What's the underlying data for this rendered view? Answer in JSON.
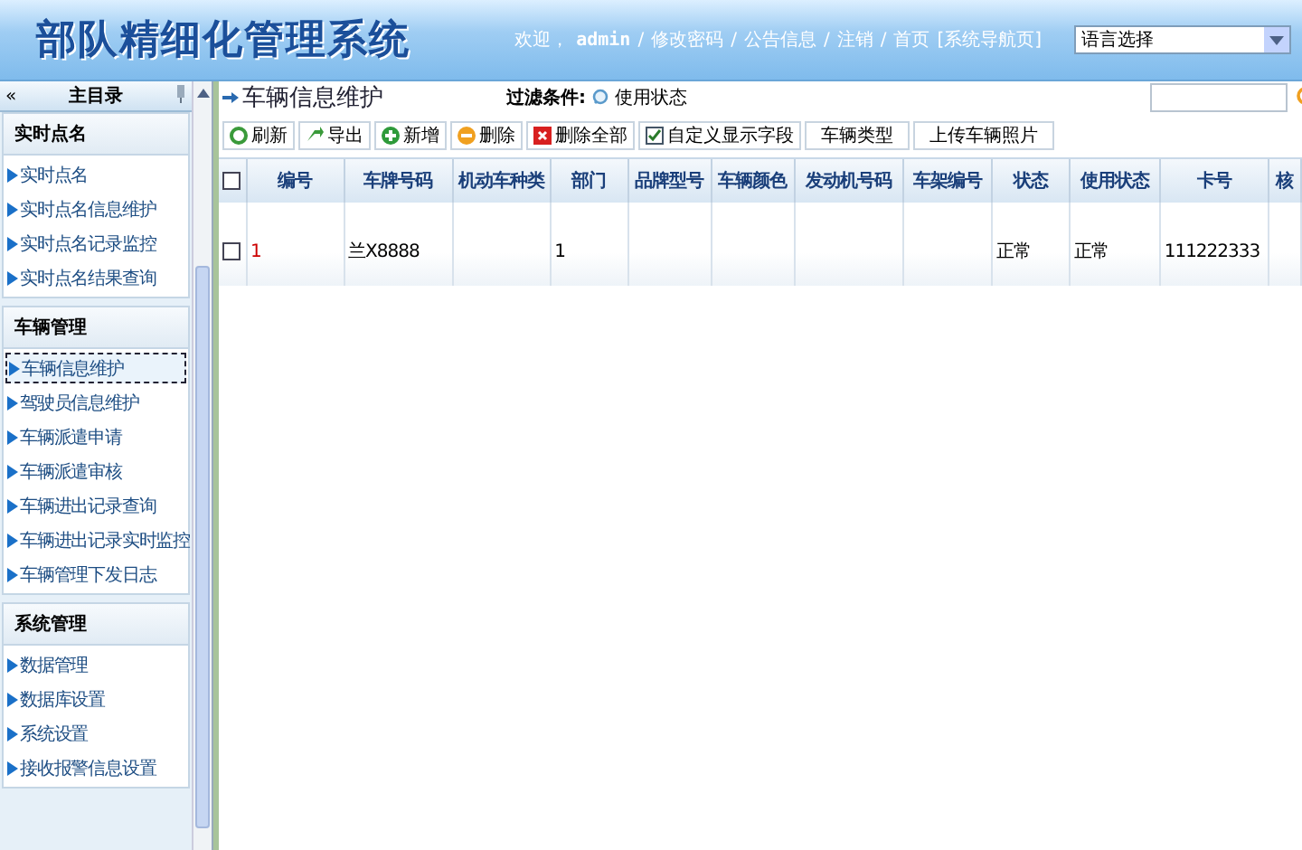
{
  "header": {
    "title": "部队精细化管理系统",
    "links": [
      {
        "kind": "text",
        "label": "欢迎，"
      },
      {
        "kind": "user",
        "label": "admin"
      },
      {
        "kind": "sep",
        "label": "/"
      },
      {
        "kind": "link",
        "label": "修改密码"
      },
      {
        "kind": "sep",
        "label": "/"
      },
      {
        "kind": "link",
        "label": "公告信息"
      },
      {
        "kind": "sep",
        "label": "/"
      },
      {
        "kind": "link",
        "label": "注销"
      },
      {
        "kind": "sep",
        "label": "/"
      },
      {
        "kind": "link",
        "label": "首页"
      },
      {
        "kind": "link",
        "label": "[系统导航页]"
      }
    ],
    "language_select": {
      "value": "语言选择"
    }
  },
  "sidebar": {
    "collapse": "«",
    "title": "主目录",
    "sections": [
      {
        "title": "实时点名",
        "items": [
          {
            "label": "实时点名",
            "selected": false
          },
          {
            "label": "实时点名信息维护",
            "selected": false
          },
          {
            "label": "实时点名记录监控",
            "selected": false
          },
          {
            "label": "实时点名结果查询",
            "selected": false
          }
        ]
      },
      {
        "title": "车辆管理",
        "items": [
          {
            "label": "车辆信息维护",
            "selected": true
          },
          {
            "label": "驾驶员信息维护",
            "selected": false
          },
          {
            "label": "车辆派遣申请",
            "selected": false
          },
          {
            "label": "车辆派遣审核",
            "selected": false
          },
          {
            "label": "车辆进出记录查询",
            "selected": false
          },
          {
            "label": "车辆进出记录实时监控",
            "selected": false
          },
          {
            "label": "车辆管理下发日志",
            "selected": false
          }
        ]
      },
      {
        "title": "系统管理",
        "items": [
          {
            "label": "数据管理",
            "selected": false
          },
          {
            "label": "数据库设置",
            "selected": false
          },
          {
            "label": "系统设置",
            "selected": false
          },
          {
            "label": "接收报警信息设置",
            "selected": false
          }
        ]
      }
    ]
  },
  "main": {
    "title": "车辆信息维护",
    "filter": {
      "label": "过滤条件:",
      "value": "使用状态"
    },
    "toolbar": [
      {
        "kind": "refresh",
        "label": "刷新"
      },
      {
        "kind": "export",
        "label": "导出"
      },
      {
        "kind": "add",
        "label": "新增"
      },
      {
        "kind": "delete",
        "label": "删除"
      },
      {
        "kind": "delete_all",
        "label": "删除全部"
      },
      {
        "kind": "fields",
        "label": "自定义显示字段"
      },
      {
        "kind": "plain",
        "label": "车辆类型"
      },
      {
        "kind": "plain",
        "label": "上传车辆照片"
      }
    ],
    "table": {
      "select_all": {
        "checked": false
      },
      "columns": [
        "编号",
        "车牌号码",
        "机动车种类",
        "部门",
        "品牌型号",
        "车辆颜色",
        "发动机号码",
        "车架编号",
        "状态",
        "使用状态",
        "卡号",
        "核"
      ],
      "rows": [
        {
          "checked": false,
          "cells": [
            "1",
            "兰X8888",
            "",
            "1",
            "",
            "",
            "",
            "",
            "正常",
            "正常",
            "111222333",
            ""
          ]
        }
      ]
    }
  }
}
